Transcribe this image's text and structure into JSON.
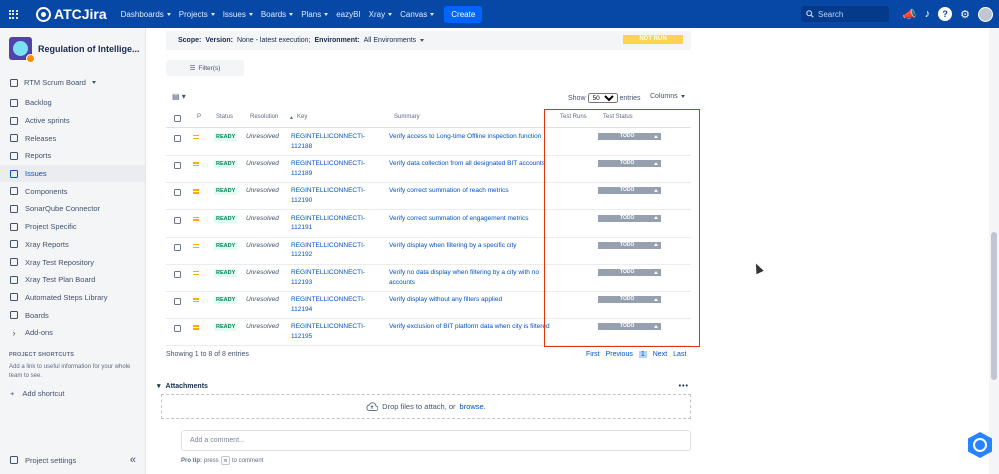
{
  "topnav": {
    "logo_text": "ATCJira",
    "menu": [
      {
        "label": "Dashboards",
        "caret": true
      },
      {
        "label": "Projects",
        "caret": true
      },
      {
        "label": "Issues",
        "caret": true
      },
      {
        "label": "Boards",
        "caret": true
      },
      {
        "label": "Plans",
        "caret": true
      },
      {
        "label": "eazyBI",
        "caret": false
      },
      {
        "label": "Xray",
        "caret": true
      },
      {
        "label": "Canvas",
        "caret": true
      }
    ],
    "create_label": "Create",
    "search_placeholder": "Search"
  },
  "sidebar": {
    "project_name": "Regulation of Intellige...",
    "board_selector": "RTM Scrum Board",
    "items": [
      {
        "label": "Backlog",
        "icon": "backlog-icon",
        "active": false
      },
      {
        "label": "Active sprints",
        "icon": "sprint-icon",
        "active": false
      },
      {
        "label": "Releases",
        "icon": "ship-icon",
        "active": false
      },
      {
        "label": "Reports",
        "icon": "chart-icon",
        "active": false
      },
      {
        "label": "Issues",
        "icon": "issues-icon",
        "active": true
      },
      {
        "label": "Components",
        "icon": "component-icon",
        "active": false
      },
      {
        "label": "SonarQube Connector",
        "icon": "sonar-icon",
        "active": false
      },
      {
        "label": "Project Specific",
        "icon": "page-icon",
        "active": false
      },
      {
        "label": "Xray Reports",
        "icon": "xray-icon",
        "active": false
      },
      {
        "label": "Xray Test Repository",
        "icon": "xray-icon",
        "active": false
      },
      {
        "label": "Xray Test Plan Board",
        "icon": "board-icon",
        "active": false
      },
      {
        "label": "Automated Steps Library",
        "icon": "library-icon",
        "active": false
      },
      {
        "label": "Boards",
        "icon": "board-icon",
        "active": false
      }
    ],
    "addons_label": "Add-ons",
    "shortcuts_heading": "PROJECT SHORTCUTS",
    "shortcuts_text": "Add a link to useful information for your whole team to see.",
    "add_shortcut": "Add shortcut",
    "project_settings": "Project settings"
  },
  "scope": {
    "scope_label": "Scope:",
    "version_label": "Version:",
    "version_value": "None - latest execution;",
    "env_label": "Environment:",
    "env_value": "All Environments",
    "status": "NOT RUN"
  },
  "filter_label": "Filter(s)",
  "table_controls": {
    "show_label": "Show",
    "entries_value": "50",
    "entries_label": "entries",
    "columns_label": "Columns"
  },
  "columns": {
    "priority": "P",
    "status": "Status",
    "resolution": "Resolution",
    "key": "Key",
    "summary": "Summary",
    "test_runs": "Test Runs",
    "test_status": "Test Status"
  },
  "rows": [
    {
      "status": "READY",
      "resolution": "Unresolved",
      "key": "REGINTELLICONNECTI-112188",
      "summary": "Verify access to Long-time Offline inspection function",
      "test_status": "TODO"
    },
    {
      "status": "READY",
      "resolution": "Unresolved",
      "key": "REGINTELLICONNECTI-112189",
      "summary": "Verify data collection from all designated BIT accounts",
      "test_status": "TODO"
    },
    {
      "status": "READY",
      "resolution": "Unresolved",
      "key": "REGINTELLICONNECTI-112190",
      "summary": "Verify correct summation of reach metrics",
      "test_status": "TODO"
    },
    {
      "status": "READY",
      "resolution": "Unresolved",
      "key": "REGINTELLICONNECTI-112191",
      "summary": "Verify correct summation of engagement metrics",
      "test_status": "TODO"
    },
    {
      "status": "READY",
      "resolution": "Unresolved",
      "key": "REGINTELLICONNECTI-112192",
      "summary": "Verify display when filtering by a specific city",
      "test_status": "TODO"
    },
    {
      "status": "READY",
      "resolution": "Unresolved",
      "key": "REGINTELLICONNECTI-112193",
      "summary": "Verify no data display when filtering by a city with no accounts",
      "test_status": "TODO"
    },
    {
      "status": "READY",
      "resolution": "Unresolved",
      "key": "REGINTELLICONNECTI-112194",
      "summary": "Verify display without any filters applied",
      "test_status": "TODO"
    },
    {
      "status": "READY",
      "resolution": "Unresolved",
      "key": "REGINTELLICONNECTI-112195",
      "summary": "Verify exclusion of BIT platform data when city is filtered",
      "test_status": "TODO"
    }
  ],
  "pagination": {
    "showing": "Showing 1 to 8 of 8 entries",
    "first": "First",
    "previous": "Previous",
    "current": "1",
    "next": "Next",
    "last": "Last"
  },
  "attachments": {
    "title": "Attachments",
    "more": "•••",
    "drop_text": "Drop files to attach, or",
    "browse": "browse."
  },
  "comment": {
    "placeholder": "Add a comment...",
    "protip_label": "Pro tip:",
    "protip_press": "press",
    "protip_key": "m",
    "protip_tail": "to comment"
  },
  "colors": {
    "nav_bg": "#0747a6",
    "link": "#0052cc",
    "ready": "#00875a",
    "todo_bg": "#97a0af",
    "not_run_bg": "#ffd351",
    "highlight_box": "#de350b"
  }
}
